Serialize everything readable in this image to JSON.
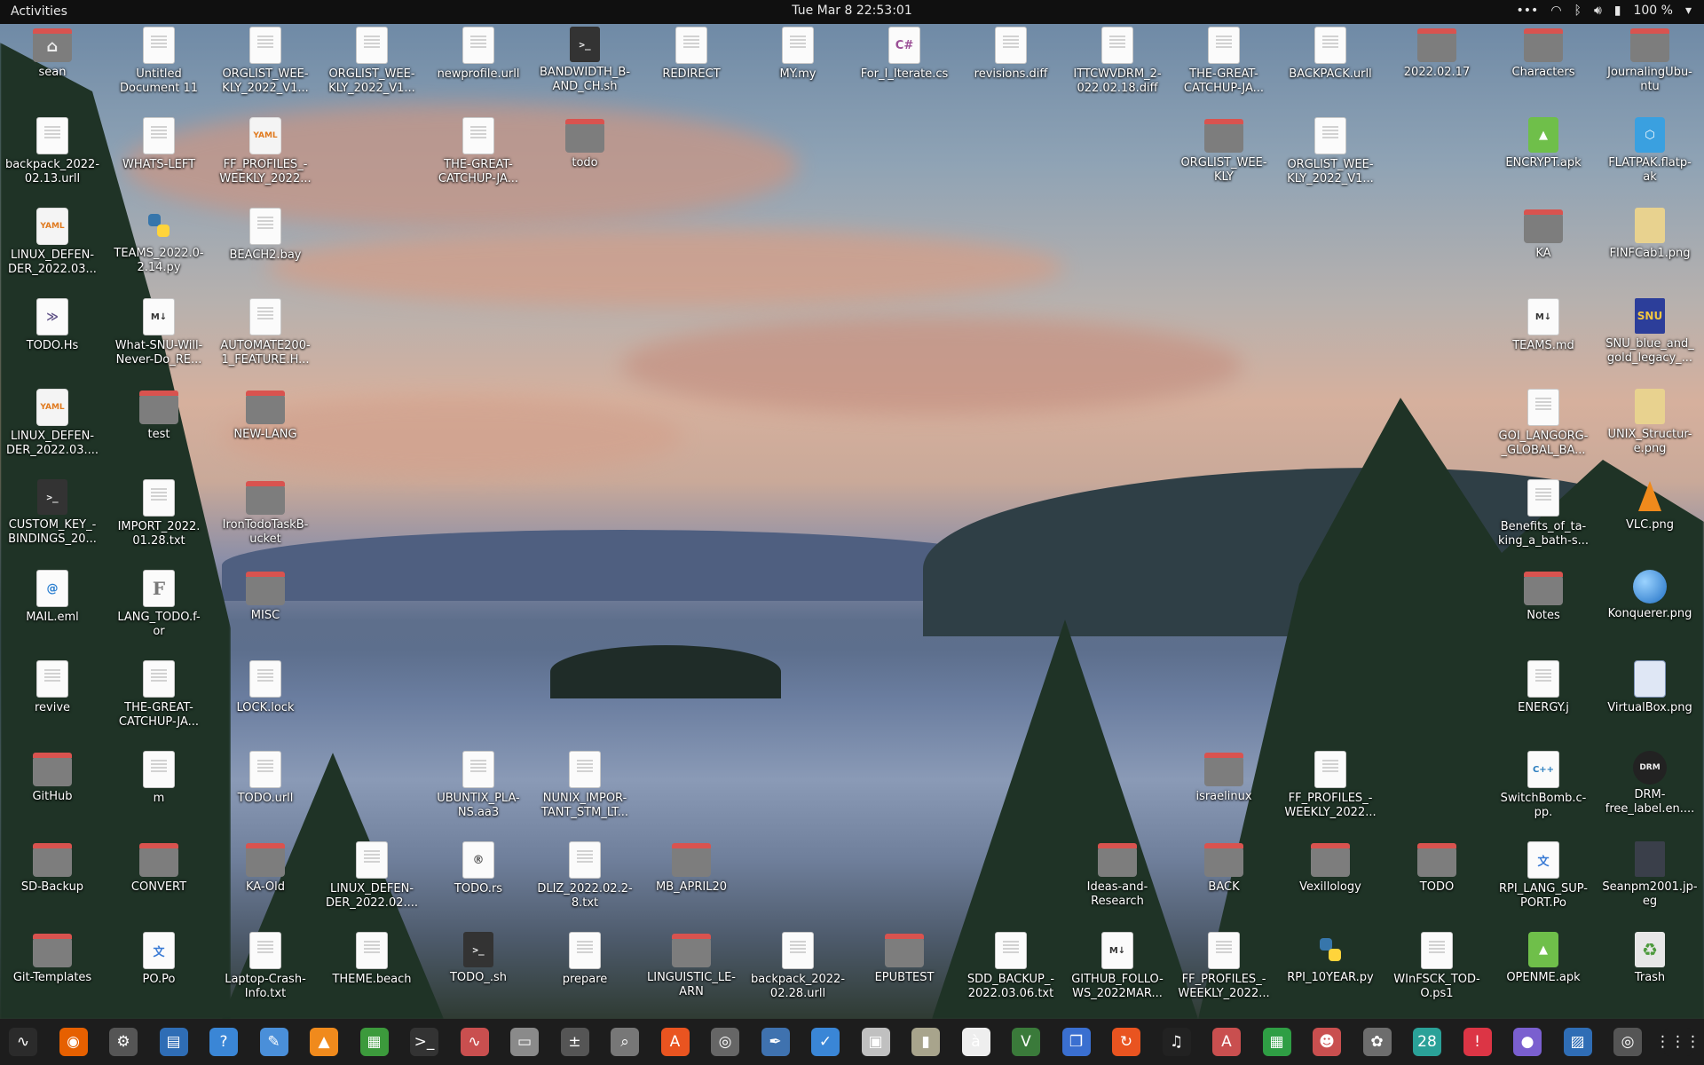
{
  "topbar": {
    "activities": "Activities",
    "clock": "Tue Mar 8  22:53:01",
    "battery": "100 %"
  },
  "icons": [
    {
      "label": "sean",
      "kind": "folder home"
    },
    {
      "label": "Untitled\nDocument 11",
      "kind": "doc"
    },
    {
      "label": "ORGLIST_WEE-\nKLY_2022_V1...",
      "kind": "doc"
    },
    {
      "label": "ORGLIST_WEE-\nKLY_2022_V1...",
      "kind": "doc"
    },
    {
      "label": "newprofile.urll",
      "kind": "doc"
    },
    {
      "label": "BANDWIDTH_B-\nAND_CH.sh",
      "kind": "term"
    },
    {
      "label": "REDIRECT",
      "kind": "doc"
    },
    {
      "label": "MY.my",
      "kind": "doc"
    },
    {
      "label": "For_I_Iterate.cs",
      "kind": "cs"
    },
    {
      "label": "revisions.diff",
      "kind": "doc"
    },
    {
      "label": "ITTCWVDRM_2-\n022.02.18.diff",
      "kind": "doc"
    },
    {
      "label": "THE-GREAT-\nCATCHUP-JA...",
      "kind": "doc"
    },
    {
      "label": "BACKPACK.urll",
      "kind": "doc"
    },
    {
      "label": "2022.02.17",
      "kind": "folder"
    },
    {
      "label": "Characters",
      "kind": "folder"
    },
    {
      "label": "JournalingUbu-\nntu",
      "kind": "folder"
    },
    {
      "label": "backpack_2022-\n02.13.urll",
      "kind": "doc"
    },
    {
      "label": "WHATS-LEFT",
      "kind": "doc"
    },
    {
      "label": "FF_PROFILES_-\nWEEKLY_2022...",
      "kind": "yaml"
    },
    {
      "label": "THE-GREAT-\nCATCHUP-JA...",
      "kind": "doc"
    },
    {
      "label": "todo",
      "kind": "folder"
    },
    {
      "label": "ORGLIST_WEE-\nKLY",
      "kind": "folder"
    },
    {
      "label": "ORGLIST_WEE-\nKLY_2022_V1...",
      "kind": "doc"
    },
    {
      "label": "ENCRYPT.apk",
      "kind": "apk"
    },
    {
      "label": "FLATPAK.flatp-\nak",
      "kind": "flatpak"
    },
    {
      "label": "LINUX_DEFEN-\nDER_2022.03...",
      "kind": "yaml"
    },
    {
      "label": "TEAMS_2022.0-\n2.14.py",
      "kind": "py"
    },
    {
      "label": "BEACH2.bay",
      "kind": "doc"
    },
    {
      "label": "KA",
      "kind": "folder"
    },
    {
      "label": "FINFCab1.png",
      "kind": "img"
    },
    {
      "label": "TODO.Hs",
      "kind": "hs"
    },
    {
      "label": "What-SNU-Will-\nNever-Do_RE...",
      "kind": "md"
    },
    {
      "label": "AUTOMATE200-\n1_FEATURE.H...",
      "kind": "doc"
    },
    {
      "label": "TEAMS.md",
      "kind": "md"
    },
    {
      "label": "SNU_blue_and_\ngold_legacy_...",
      "kind": "snu"
    },
    {
      "label": "LINUX_DEFEN-\nDER_2022.03....",
      "kind": "yaml"
    },
    {
      "label": "test",
      "kind": "folder"
    },
    {
      "label": "NEW-LANG",
      "kind": "folder"
    },
    {
      "label": "GOI_LANGORG-\n_GLOBAL_BA...",
      "kind": "doc"
    },
    {
      "label": "UNIX_Structur-\ne.png",
      "kind": "img"
    },
    {
      "label": "CUSTOM_KEY_-\nBINDINGS_20...",
      "kind": "term"
    },
    {
      "label": "IMPORT_2022.\n01.28.txt",
      "kind": "doc"
    },
    {
      "label": "IronTodoTaskB-\nucket",
      "kind": "folder"
    },
    {
      "label": "Benefits_of_ta-\nking_a_bath-s...",
      "kind": "doc"
    },
    {
      "label": "VLC.png",
      "kind": "vlc"
    },
    {
      "label": "MAIL.eml",
      "kind": "mail"
    },
    {
      "label": "LANG_TODO.f-\nor",
      "kind": "font"
    },
    {
      "label": "MISC",
      "kind": "folder"
    },
    {
      "label": "Notes",
      "kind": "folder"
    },
    {
      "label": "Konquerer.png",
      "kind": "globe"
    },
    {
      "label": "revive",
      "kind": "doc"
    },
    {
      "label": "THE-GREAT-\nCATCHUP-JA...",
      "kind": "doc"
    },
    {
      "label": "LOCK.lock",
      "kind": "doc"
    },
    {
      "label": "ENERGY.j",
      "kind": "doc"
    },
    {
      "label": "VirtualBox.png",
      "kind": "vbox"
    },
    {
      "label": "GitHub",
      "kind": "folder"
    },
    {
      "label": "m",
      "kind": "doc"
    },
    {
      "label": "TODO.urll",
      "kind": "doc"
    },
    {
      "label": "UBUNTIX_PLA-\nNS.aa3",
      "kind": "doc"
    },
    {
      "label": "NUNIX_IMPOR-\nTANT_STM_LT...",
      "kind": "doc"
    },
    {
      "label": "israelinux",
      "kind": "folder"
    },
    {
      "label": "FF_PROFILES_-\nWEEKLY_2022...",
      "kind": "doc"
    },
    {
      "label": "SwitchBomb.c-\npp.",
      "kind": "cpp"
    },
    {
      "label": "DRM-\nfree_label.en....",
      "kind": "drm"
    },
    {
      "label": "SD-Backup",
      "kind": "folder"
    },
    {
      "label": "CONVERT",
      "kind": "folder"
    },
    {
      "label": "KA-Old",
      "kind": "folder"
    },
    {
      "label": "LINUX_DEFEN-\nDER_2022.02....",
      "kind": "doc"
    },
    {
      "label": "TODO.rs",
      "kind": "rs"
    },
    {
      "label": "DLIZ_2022.02.2-\n8.txt",
      "kind": "doc"
    },
    {
      "label": "MB_APRIL20",
      "kind": "folder"
    },
    {
      "label": "Ideas-and-\nResearch",
      "kind": "folder"
    },
    {
      "label": "BACK",
      "kind": "folder"
    },
    {
      "label": "Vexillology",
      "kind": "folder"
    },
    {
      "label": "TODO",
      "kind": "folder"
    },
    {
      "label": "RPI_LANG_SUP-\nPORT.Po",
      "kind": "po"
    },
    {
      "label": "Seanpm2001.jp-\neg",
      "kind": "photo"
    },
    {
      "label": "Git-Templates",
      "kind": "folder"
    },
    {
      "label": "PO.Po",
      "kind": "po"
    },
    {
      "label": "Laptop-Crash-\nInfo.txt",
      "kind": "doc"
    },
    {
      "label": "THEME.beach",
      "kind": "doc"
    },
    {
      "label": "TODO_.sh",
      "kind": "term"
    },
    {
      "label": "prepare",
      "kind": "doc"
    },
    {
      "label": "LINGUISTIC_LE-\nARN",
      "kind": "folder"
    },
    {
      "label": "backpack_2022-\n02.28.urll",
      "kind": "doc"
    },
    {
      "label": "EPUBTEST",
      "kind": "folder"
    },
    {
      "label": "SDD_BACKUP_-\n2022.03.06.txt",
      "kind": "doc"
    },
    {
      "label": "GITHUB_FOLLO-\nWS_2022MAR...",
      "kind": "md"
    },
    {
      "label": "FF_PROFILES_-\nWEEKLY_2022...",
      "kind": "doc"
    },
    {
      "label": "RPI_10YEAR.py",
      "kind": "py"
    },
    {
      "label": "WInFSCK_TOD-\nO.ps1",
      "kind": "doc"
    },
    {
      "label": "OPENME.apk",
      "kind": "apk"
    },
    {
      "label": "Trash",
      "kind": "trash"
    }
  ],
  "dock": [
    {
      "name": "system-monitor-icon",
      "glyph": "∿",
      "color": "#2b2b2b"
    },
    {
      "name": "firefox-icon",
      "glyph": "◉",
      "color": "#e66000"
    },
    {
      "name": "settings-icon",
      "glyph": "⚙",
      "color": "#555555"
    },
    {
      "name": "document-viewer-icon",
      "glyph": "▤",
      "color": "#2f6db5"
    },
    {
      "name": "help-icon",
      "glyph": "?",
      "color": "#3a86d6"
    },
    {
      "name": "text-editor-icon",
      "glyph": "✎",
      "color": "#4a8fd9"
    },
    {
      "name": "vlc-icon",
      "glyph": "▲",
      "color": "#f08a1c"
    },
    {
      "name": "archive-icon",
      "glyph": "▦",
      "color": "#3c9a3c"
    },
    {
      "name": "terminal-icon",
      "glyph": ">_",
      "color": "#333333"
    },
    {
      "name": "graph-icon",
      "glyph": "∿",
      "color": "#c94f4f"
    },
    {
      "name": "files-icon",
      "glyph": "▭",
      "color": "#8a8a8a"
    },
    {
      "name": "calculator-icon",
      "glyph": "±",
      "color": "#555555"
    },
    {
      "name": "search-icon",
      "glyph": "⌕",
      "color": "#777777"
    },
    {
      "name": "software-center-icon",
      "glyph": "A",
      "color": "#e95420"
    },
    {
      "name": "disc-icon",
      "glyph": "◎",
      "color": "#666666"
    },
    {
      "name": "inkscape-icon",
      "glyph": "✒",
      "color": "#3f72af"
    },
    {
      "name": "tasks-icon",
      "glyph": "✓",
      "color": "#3a86d6"
    },
    {
      "name": "screenshot-icon",
      "glyph": "▣",
      "color": "#c0c0c0"
    },
    {
      "name": "zip-icon",
      "glyph": "▮",
      "color": "#a8a48c"
    },
    {
      "name": "character-map-icon",
      "glyph": "à",
      "color": "#eeeeee"
    },
    {
      "name": "vim-icon",
      "glyph": "V",
      "color": "#3a7a3a"
    },
    {
      "name": "window-icon",
      "glyph": "❐",
      "color": "#3a6fd0"
    },
    {
      "name": "update-icon",
      "glyph": "↻",
      "color": "#e95420"
    },
    {
      "name": "music-icon",
      "glyph": "♫",
      "color": "#222222"
    },
    {
      "name": "pdf-icon",
      "glyph": "A",
      "color": "#c94f4f"
    },
    {
      "name": "spreadsheet-icon",
      "glyph": "▦",
      "color": "#2f9e44"
    },
    {
      "name": "game-icon",
      "glyph": "☻",
      "color": "#c94f4f"
    },
    {
      "name": "gimp-icon",
      "glyph": "✿",
      "color": "#6d6d6d"
    },
    {
      "name": "calendar-icon",
      "glyph": "28",
      "color": "#2aa198"
    },
    {
      "name": "alert-icon",
      "glyph": "!",
      "color": "#dc3545"
    },
    {
      "name": "screen-recorder-icon",
      "glyph": "●",
      "color": "#7a5fcf"
    },
    {
      "name": "image-viewer-icon",
      "glyph": "▨",
      "color": "#2f6db5"
    },
    {
      "name": "cd-burner-icon",
      "glyph": "◎",
      "color": "#555555"
    },
    {
      "name": "app-grid-icon",
      "glyph": "⋮⋮⋮",
      "color": "#1d1d1d"
    }
  ]
}
